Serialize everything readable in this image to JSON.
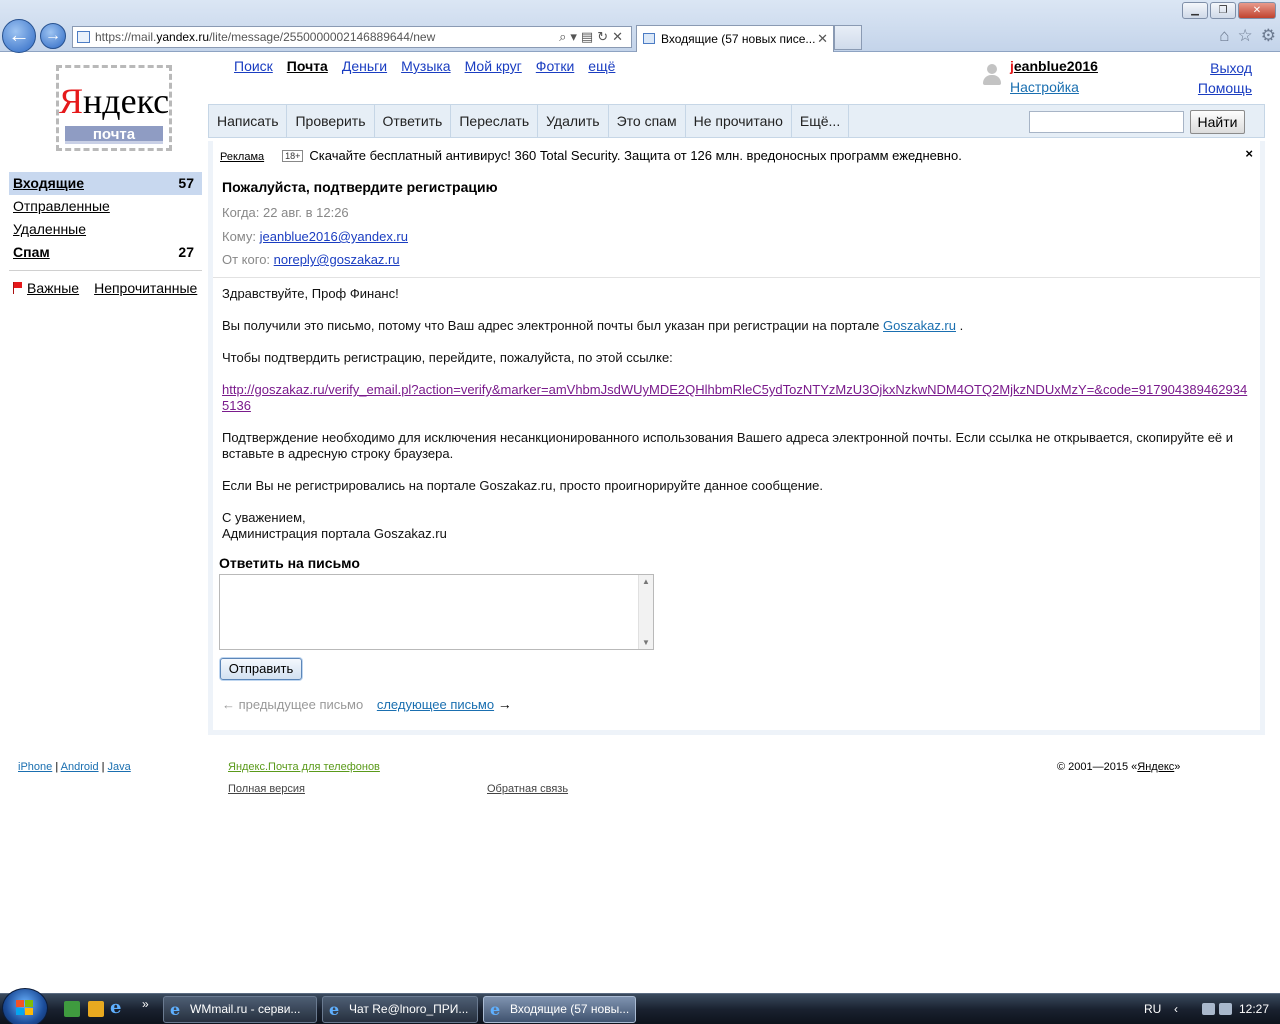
{
  "browser": {
    "url_prefix": "https://mail.",
    "url_domain": "yandex.ru",
    "url_path": "/lite/message/2550000002146889644/new",
    "tab_title": "Входящие (57 новых писе...",
    "window_buttons": [
      "minimize",
      "restore",
      "close"
    ]
  },
  "logo": {
    "brand": "Яндекс",
    "sub": "почта"
  },
  "services": [
    "Поиск",
    "Почта",
    "Деньги",
    "Музыка",
    "Мой круг",
    "Фотки",
    "ещё"
  ],
  "user": {
    "name": "jeanblue2016",
    "settings": "Настройка",
    "exit": "Выход",
    "help": "Помощь"
  },
  "toolbar": {
    "buttons": [
      "Написать",
      "Проверить",
      "Ответить",
      "Переслать",
      "Удалить",
      "Это спам",
      "Не прочитано",
      "Ещё..."
    ],
    "search_placeholder": "",
    "search_button": "Найти"
  },
  "folders": [
    {
      "name": "Входящие",
      "count": "57",
      "active": true
    },
    {
      "name": "Отправленные",
      "count": ""
    },
    {
      "name": "Удаленные",
      "count": ""
    },
    {
      "name": "Спам",
      "count": "27",
      "bold": true
    }
  ],
  "labels": {
    "important": "Важные",
    "unread": "Непрочитанные"
  },
  "ad": {
    "label": "Реклама",
    "age": "18+",
    "text": "Скачайте бесплатный антивирус! 360 Total Security. Защита от 126 млн. вредоносных программ ежедневно.",
    "close": "×"
  },
  "message": {
    "subject": "Пожалуйста, подтвердите регистрацию",
    "date_label": "Когда:",
    "date_value": "22 авг. в 12:26",
    "to_label": "Кому:",
    "to_value": "jeanblue2016@yandex.ru",
    "from_label": "От кого:",
    "from_value": "noreply@goszakaz.ru",
    "greeting": "Здравствуйте, Проф Финанс!",
    "p1_text": "Вы получили это письмо, потому что Ваш адрес электронной почты был указан при регистрации на портале",
    "p1_link": "Goszakaz.ru",
    "p1_end": ".",
    "p2": "Чтобы подтвердить регистрацию, перейдите, пожалуйста, по этой ссылке:",
    "verify_url": "http://goszakaz.ru/verify_email.pl?action=verify&marker=amVhbmJsdWUyMDE2QHlhbmRleC5ydTozNTYzMzU3OjkxNzkwNDM4OTQ2MjkzNDUxMzY=&code=9179043894629345136",
    "p3": "Подтверждение необходимо для исключения несанкционированного использования Вашего адреса электронной почты. Если ссылка не открывается, скопируйте её и вставьте в адресную строку браузера.",
    "p4": "Если Вы не регистрировались на портале Goszakaz.ru, просто проигнорируйте данное сообщение.",
    "sign1": "С уважением,",
    "sign2": "Администрация портала Goszakaz.ru"
  },
  "reply": {
    "heading": "Ответить на письмо",
    "value": "",
    "send": "Отправить"
  },
  "nav": {
    "prev": "← предыдущее письмо",
    "next": "следующее письмо",
    "next_arrow": "→"
  },
  "footer": {
    "iphone": "iPhone",
    "android": "Android",
    "java": "Java",
    "mobile": "Яндекс.Почта для телефонов",
    "full": "Полная версия",
    "feedback": "Обратная связь",
    "copy_prefix": "© 2001—2015 «",
    "copy_link": "Яндекс",
    "copy_suffix": "»"
  },
  "taskbar": {
    "tasks": [
      "WMmail.ru - серви...",
      "Чат Re@lnoro_ПРИ...",
      "Входящие (57 новы..."
    ],
    "lang": "RU",
    "time": "12:27"
  }
}
